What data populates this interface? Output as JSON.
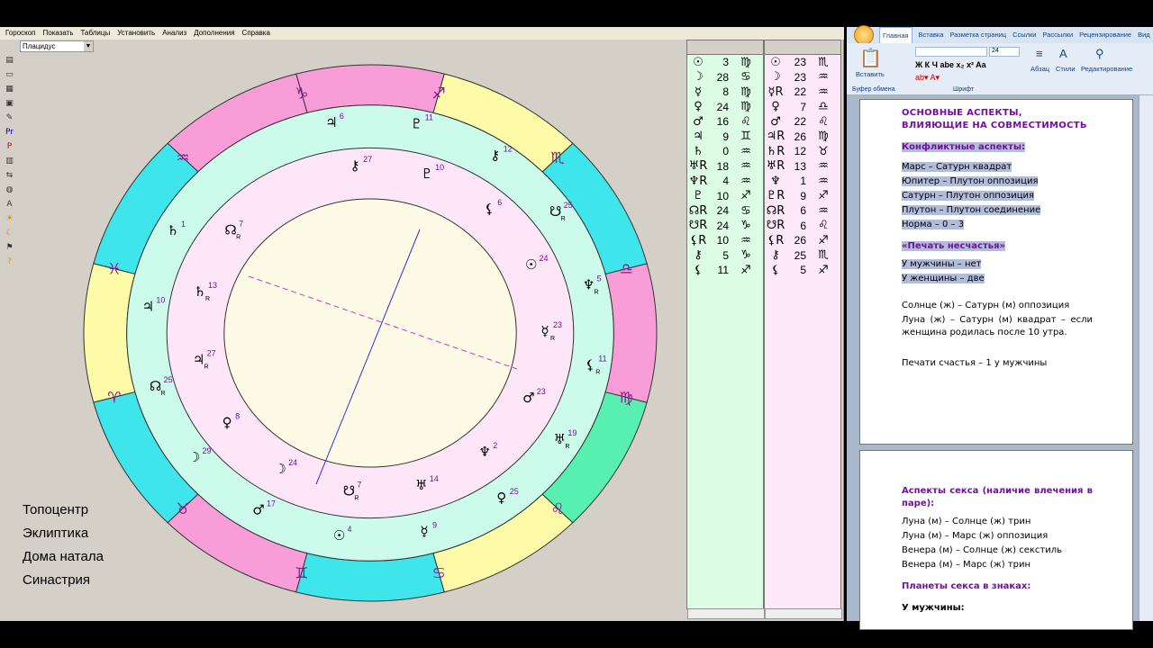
{
  "menu": [
    "Гороскоп",
    "Показать",
    "Таблицы",
    "Установить",
    "Анализ",
    "Дополнения",
    "Справка"
  ],
  "house_system": "Плацидус",
  "toolbar_icons": [
    "folder-open-icon",
    "open-icon",
    "print-icon",
    "export-icon",
    "edit-icon",
    "Pr",
    "P",
    "chart-icon",
    "compare-icon",
    "globe-icon",
    "A",
    "sun-icon",
    "moon-icon",
    "flag-icon",
    "help-icon"
  ],
  "zodiac_signs": [
    {
      "glyph": "♑",
      "color": "#f89dd8"
    },
    {
      "glyph": "♐",
      "color": "#f89dd8"
    },
    {
      "glyph": "♏",
      "color": "#3ee6ec"
    },
    {
      "glyph": "♎",
      "color": "#fdfba8"
    },
    {
      "glyph": "♍",
      "color": "#3ee6ec"
    },
    {
      "glyph": "♌",
      "color": "#f89dd8"
    },
    {
      "glyph": "♋",
      "color": "#3ee6ec"
    },
    {
      "glyph": "♊",
      "color": "#fdfba8"
    },
    {
      "glyph": "♉",
      "color": "#58f0b0"
    },
    {
      "glyph": "♈",
      "color": "#f89dd8"
    },
    {
      "glyph": "♓",
      "color": "#3ee6ec"
    },
    {
      "glyph": "♒",
      "color": "#fdfba8"
    }
  ],
  "outer_planets": [
    {
      "glyph": "♃",
      "deg": "6",
      "sub": ""
    },
    {
      "glyph": "♇",
      "deg": "11",
      "sub": ""
    },
    {
      "glyph": "⚷",
      "deg": "12",
      "sub": ""
    },
    {
      "glyph": "☋",
      "deg": "25",
      "sub": "R"
    },
    {
      "glyph": "♆",
      "deg": "5",
      "sub": "R"
    },
    {
      "glyph": "⚸",
      "deg": "11",
      "sub": "R"
    },
    {
      "glyph": "♅",
      "deg": "19",
      "sub": "R"
    },
    {
      "glyph": "♀",
      "deg": "25",
      "sub": ""
    },
    {
      "glyph": "☿",
      "deg": "9",
      "sub": ""
    },
    {
      "glyph": "☉",
      "deg": "4",
      "sub": ""
    },
    {
      "glyph": "♂",
      "deg": "17",
      "sub": ""
    },
    {
      "glyph": "☽",
      "deg": "29",
      "sub": ""
    },
    {
      "glyph": "☊",
      "deg": "25",
      "sub": "R"
    },
    {
      "glyph": "♃",
      "deg": "10",
      "sub": ""
    },
    {
      "glyph": "♄",
      "deg": "1",
      "sub": ""
    }
  ],
  "inner_planets": [
    {
      "glyph": "⚷",
      "deg": "27",
      "sub": ""
    },
    {
      "glyph": "♇",
      "deg": "10",
      "sub": ""
    },
    {
      "glyph": "⚸",
      "deg": "6",
      "sub": ""
    },
    {
      "glyph": "☉",
      "deg": "24",
      "sub": ""
    },
    {
      "glyph": "☿",
      "deg": "23",
      "sub": "R"
    },
    {
      "glyph": "♂",
      "deg": "23",
      "sub": ""
    },
    {
      "glyph": "♆",
      "deg": "2",
      "sub": ""
    },
    {
      "glyph": "♅",
      "deg": "14",
      "sub": ""
    },
    {
      "glyph": "☋",
      "deg": "7",
      "sub": "R"
    },
    {
      "glyph": "☽",
      "deg": "24",
      "sub": ""
    },
    {
      "glyph": "♀",
      "deg": "8",
      "sub": ""
    },
    {
      "glyph": "♃",
      "deg": "27",
      "sub": "R"
    },
    {
      "glyph": "♄",
      "deg": "13",
      "sub": "R"
    },
    {
      "glyph": "☊",
      "deg": "7",
      "sub": "R"
    }
  ],
  "legend": [
    "Топоцентр",
    "Эклиптика",
    "Дома натала",
    "Синастрия"
  ],
  "table_left": [
    {
      "g": "☉",
      "d": "3",
      "s": "♍"
    },
    {
      "g": "☽",
      "d": "28",
      "s": "♋"
    },
    {
      "g": "☿",
      "d": "8",
      "s": "♍"
    },
    {
      "g": "♀",
      "d": "24",
      "s": "♍"
    },
    {
      "g": "♂",
      "d": "16",
      "s": "♌"
    },
    {
      "g": "♃",
      "d": "9",
      "s": "♊"
    },
    {
      "g": "♄",
      "d": "0",
      "s": "♒"
    },
    {
      "g": "♅R",
      "d": "18",
      "s": "♒"
    },
    {
      "g": "♆R",
      "d": "4",
      "s": "♒"
    },
    {
      "g": "♇",
      "d": "10",
      "s": "♐"
    },
    {
      "g": "☊R",
      "d": "24",
      "s": "♋"
    },
    {
      "g": "☋R",
      "d": "24",
      "s": "♑"
    },
    {
      "g": "⚸R",
      "d": "10",
      "s": "♒"
    },
    {
      "g": "⚷",
      "d": "5",
      "s": "♑"
    },
    {
      "g": "⚸",
      "d": "11",
      "s": "♐"
    }
  ],
  "table_right": [
    {
      "g": "☉",
      "d": "23",
      "s": "♏"
    },
    {
      "g": "☽",
      "d": "23",
      "s": "♒"
    },
    {
      "g": "☿R",
      "d": "22",
      "s": "♒"
    },
    {
      "g": "♀",
      "d": "7",
      "s": "♎"
    },
    {
      "g": "♂",
      "d": "22",
      "s": "♌"
    },
    {
      "g": "♃R",
      "d": "26",
      "s": "♍"
    },
    {
      "g": "♄R",
      "d": "12",
      "s": "♉"
    },
    {
      "g": "♅R",
      "d": "13",
      "s": "♒"
    },
    {
      "g": "♆",
      "d": "1",
      "s": "♒"
    },
    {
      "g": "♇R",
      "d": "9",
      "s": "♐"
    },
    {
      "g": "☊R",
      "d": "6",
      "s": "♒"
    },
    {
      "g": "☋R",
      "d": "6",
      "s": "♌"
    },
    {
      "g": "⚸R",
      "d": "26",
      "s": "♐"
    },
    {
      "g": "⚷",
      "d": "25",
      "s": "♏"
    },
    {
      "g": "⚸",
      "d": "5",
      "s": "♐"
    }
  ],
  "word": {
    "tabs": [
      "Главная",
      "Вставка",
      "Разметка страниц",
      "Ссылки",
      "Рассылки",
      "Рецензирование",
      "Вид"
    ],
    "paste_label": "Вставить",
    "clipboard_label": "Буфер обмена",
    "font_group_label": "Шрифт",
    "font_size": "24",
    "paragraph_label": "Абзац",
    "styles_label": "Стили",
    "editing_label": "Редактирование",
    "page1": {
      "heading": "ОСНОВНЫЕ АСПЕКТЫ, ВЛИЯЮЩИЕ НА СОВМЕСТИМОСТЬ",
      "conflict_title": "Конфликтные аспекты:",
      "conflict_items": [
        "Марс – Сатурн квадрат",
        "Юпитер – Плутон оппозиция",
        "Сатурн – Плутон оппозиция",
        "Плутон – Плутон соединение",
        "Норма – 0 – 3"
      ],
      "misfortune_title": "«Печать несчастья»",
      "misfortune_items": [
        "У мужчины – нет",
        "У женщины – две"
      ],
      "line1": "Солнце (ж) – Сатурн (м) оппозиция",
      "line2": "Луна (ж) – Сатурн (м) квадрат – если женщина родилась после 10 утра.",
      "line3": "Печати счастья – 1 у мужчины"
    },
    "page2": {
      "heading": "Аспекты секса (наличие влечения в паре):",
      "items": [
        "Луна (м) – Солнце (ж) трин",
        "Луна (м) – Марс (ж) оппозиция",
        "Венера (м) – Солнце (ж) секстиль",
        "Венера (м) – Марс (ж) трин"
      ],
      "planets_title": "Планеты секса в знаках:",
      "male_title": "У мужчины:"
    }
  }
}
